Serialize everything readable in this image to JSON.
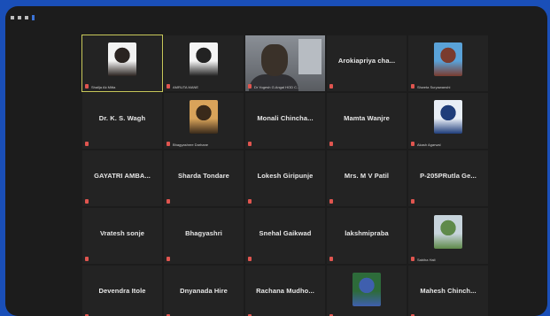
{
  "participants": [
    {
      "name": "",
      "caption": "Shailja Ak Mitta",
      "type": "photo",
      "photo_colors": [
        "#f2f2f2",
        "#2a2320"
      ],
      "active": true
    },
    {
      "name": "",
      "caption": "AMRUTA MANE",
      "type": "photo",
      "photo_colors": [
        "#f4f4f4",
        "#222"
      ]
    },
    {
      "name": "",
      "caption": "Dr Yogesh G.Angal HOD C...",
      "type": "video"
    },
    {
      "name": "Arokiapriya cha...",
      "caption": ""
    },
    {
      "name": "",
      "caption": "Shweta Suryawanshi",
      "type": "photo",
      "photo_colors": [
        "#5aa2d8",
        "#7a3b2e"
      ]
    },
    {
      "name": "Dr. K. S. Wagh",
      "caption": ""
    },
    {
      "name": "",
      "caption": "Bhagyashree Darhane",
      "type": "photo",
      "photo_colors": [
        "#d9a35a",
        "#3a2a1a"
      ]
    },
    {
      "name": "Monali Chincha...",
      "caption": ""
    },
    {
      "name": "Mamta Wanjre",
      "caption": ""
    },
    {
      "name": "",
      "caption": "Akash Agarwal",
      "type": "photo",
      "photo_colors": [
        "#e8eef6",
        "#1f3d7a"
      ]
    },
    {
      "name": "GAYATRI AMBA...",
      "caption": ""
    },
    {
      "name": "Sharda Tondare",
      "caption": ""
    },
    {
      "name": "Lokesh Giripunje",
      "caption": ""
    },
    {
      "name": "Mrs. M V Patil",
      "caption": ""
    },
    {
      "name": "P-205PRutla Ge...",
      "caption": ""
    },
    {
      "name": "Vratesh sonje",
      "caption": ""
    },
    {
      "name": "Bhagyashri",
      "caption": ""
    },
    {
      "name": "Snehal Gaikwad",
      "caption": ""
    },
    {
      "name": "lakshmipraba",
      "caption": ""
    },
    {
      "name": "",
      "caption": "Sabiha Hali",
      "type": "photo",
      "photo_colors": [
        "#c7d4dc",
        "#5f8a4a"
      ]
    },
    {
      "name": "Devendra Itole",
      "caption": ""
    },
    {
      "name": "Dnyanada Hire",
      "caption": ""
    },
    {
      "name": "Rachana Mudho...",
      "caption": ""
    },
    {
      "name": "",
      "caption": "",
      "type": "photo",
      "photo_colors": [
        "#2d6b3a",
        "#3f5fae"
      ]
    },
    {
      "name": "Mahesh Chinch...",
      "caption": ""
    }
  ]
}
